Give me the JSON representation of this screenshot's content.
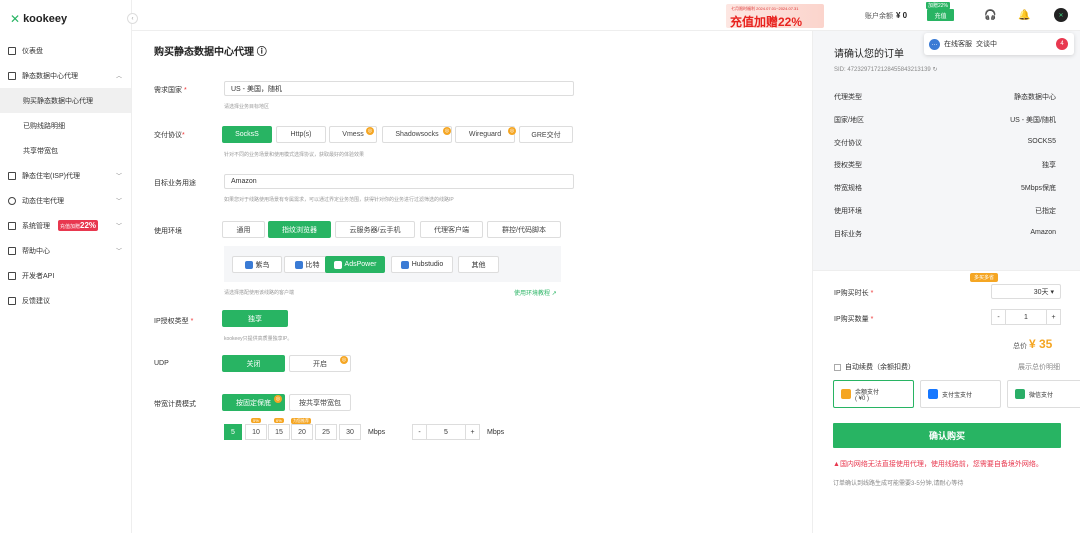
{
  "brand": {
    "name": "kookeey",
    "mark": "✕"
  },
  "sidebar": {
    "items": [
      {
        "label": "仪表盘"
      },
      {
        "label": "静态数据中心代理"
      },
      {
        "label": "购买静态数据中心代理"
      },
      {
        "label": "已购线路明细"
      },
      {
        "label": "共享带宽包"
      },
      {
        "label": "静态住宅(ISP)代理"
      },
      {
        "label": "动态住宅代理"
      },
      {
        "label": "系统管理"
      },
      {
        "label": "帮助中心"
      },
      {
        "label": "开发者API"
      },
      {
        "label": "反馈建议"
      }
    ],
    "promo_text": "充值加赠",
    "promo_pct": "22%"
  },
  "topbar": {
    "banner_line1": "七月限时福利 2024.07.01~2024.07.31",
    "banner_line2": "充值加赠22%",
    "balance_label": "账户余额",
    "balance_value": "¥ 0",
    "recharge_label": "充值",
    "recharge_tag": "加赠22%"
  },
  "chat": {
    "label": "在线客服",
    "status": "交谈中",
    "unread": "4"
  },
  "main": {
    "title": "购买静态数据中心代理",
    "country": {
      "label": "需求国家",
      "value": "US - 美国，随机",
      "hint": "请选择业务目标地区"
    },
    "protocol": {
      "label": "交付协议",
      "options": [
        "SocksS",
        "Http(s)",
        "Vmess",
        "Shadowsocks",
        "Wireguard",
        "GRE交付"
      ],
      "hint": "针对不同的业务场景和使用模式选择协议，获取最好的体验效果"
    },
    "target": {
      "label": "目标业务用途",
      "value": "Amazon",
      "hint": "如果您对于线路使用场景有专属需求，可以通过界定业务范围，获得针对你的业务进行过滤筛选的线路IP"
    },
    "env": {
      "label": "使用环境",
      "options": [
        "通用",
        "指纹浏览器",
        "云服务器/云手机",
        "代理客户端",
        "群控/代码脚本"
      ],
      "browsers": [
        "紫鸟",
        "比特",
        "AdsPower",
        "Hubstudio",
        "其他"
      ],
      "hint": "请选择搭配使用该线路的客户端",
      "tutorial": "使用环境教程"
    },
    "auth": {
      "label": "IP授权类型",
      "option": "独享",
      "hint": "kookeey只提供高质量独享IP。"
    },
    "udp": {
      "label": "UDP",
      "options": [
        "关闭",
        "开启"
      ]
    },
    "billing": {
      "label": "带宽计费模式",
      "options": [
        "按固定保底",
        "按共享带宽包"
      ],
      "values": [
        "5",
        "10",
        "15",
        "20",
        "25",
        "30"
      ],
      "unit": "Mbps",
      "tag1": "5%",
      "tag2": "6%",
      "tag3": "为您推荐",
      "stepper_value": "5",
      "stepper_unit": "Mbps",
      "minus": "-",
      "plus": "+"
    }
  },
  "order": {
    "title": "请确认您的订单",
    "sid": "SID: 4723297172128455843213139",
    "rows": [
      {
        "k": "代理类型",
        "v": "静态数据中心"
      },
      {
        "k": "国家/地区",
        "v": "US - 美国/随机"
      },
      {
        "k": "交付协议",
        "v": "SOCKS5"
      },
      {
        "k": "授权类型",
        "v": "独享"
      },
      {
        "k": "带宽规格",
        "v": "5Mbps保底"
      },
      {
        "k": "使用环境",
        "v": "已指定"
      },
      {
        "k": "目标业务",
        "v": "Amazon"
      }
    ],
    "duration_label": "IP购买时长",
    "duration_value": "30天",
    "duration_tag": "多买多省",
    "qty_label": "IP购买数量",
    "qty_value": "1",
    "total_label": "总价",
    "total_value": "¥ 35",
    "autorenew": "自动续费（余额扣费）",
    "detail_link": "展示总价明细",
    "pay": [
      "余额支付",
      "支付宝支付",
      "微信支付"
    ],
    "pay_sub": "( ¥0 )",
    "buy": "确认购买",
    "warning": "国内网络无法直接使用代理，使用线路前，您需要自备境外网络。",
    "note": "订单确认到线路生成可能需要3-5分钟,请耐心等待"
  }
}
